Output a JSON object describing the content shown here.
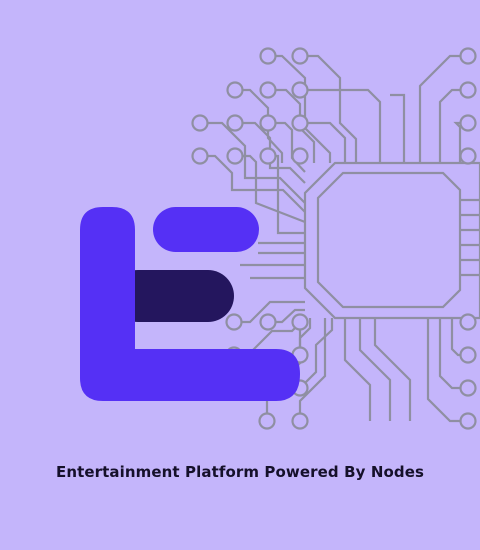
{
  "tagline": "Entertainment Platform Powered By Nodes",
  "colors": {
    "background": "#c4b5fb",
    "circuit": "#8f8fa2",
    "logo_primary": "#5530f5",
    "logo_dark": "#24165e",
    "text": "#15102a"
  },
  "icons": [
    "circuit-chip-illustration",
    "brand-logo-mark"
  ]
}
